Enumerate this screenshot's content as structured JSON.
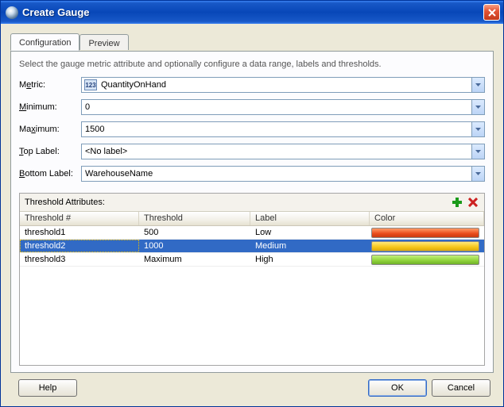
{
  "window": {
    "title": "Create Gauge"
  },
  "tabs": {
    "configuration": "Configuration",
    "preview": "Preview"
  },
  "description": "Select the gauge metric attribute and optionally configure a data range, labels and thresholds.",
  "labels": {
    "metric_pre": "M",
    "metric_ul": "e",
    "metric_post": "tric:",
    "minimum_ul": "M",
    "minimum_post": "inimum:",
    "maximum_pre": "Ma",
    "maximum_ul": "x",
    "maximum_post": "imum:",
    "toplabel_ul": "T",
    "toplabel_post": "op Label:",
    "bottomlabel_ul": "B",
    "bottomlabel_post": "ottom Label:"
  },
  "fields": {
    "metric_icon": "123",
    "metric": "QuantityOnHand",
    "minimum": "0",
    "maximum": "1500",
    "top_label": "<No label>",
    "bottom_label": "WarehouseName"
  },
  "threshold": {
    "title": "Threshold Attributes:",
    "columns": {
      "num": "Threshold #",
      "thr": "Threshold",
      "label": "Label",
      "color": "Color"
    },
    "rows": [
      {
        "num": "threshold1",
        "thr": "500",
        "label": "Low",
        "color": "red",
        "selected": false
      },
      {
        "num": "threshold2",
        "thr": "1000",
        "label": "Medium",
        "color": "yellow",
        "selected": true
      },
      {
        "num": "threshold3",
        "thr": "Maximum",
        "label": "High",
        "color": "green",
        "selected": false
      }
    ]
  },
  "buttons": {
    "help": "Help",
    "ok": "OK",
    "cancel": "Cancel"
  },
  "chart_data": {
    "type": "table",
    "title": "Threshold Attributes",
    "columns": [
      "Threshold #",
      "Threshold",
      "Label",
      "Color"
    ],
    "rows": [
      [
        "threshold1",
        "500",
        "Low",
        "red"
      ],
      [
        "threshold2",
        "1000",
        "Medium",
        "yellow"
      ],
      [
        "threshold3",
        "Maximum",
        "High",
        "green"
      ]
    ]
  }
}
